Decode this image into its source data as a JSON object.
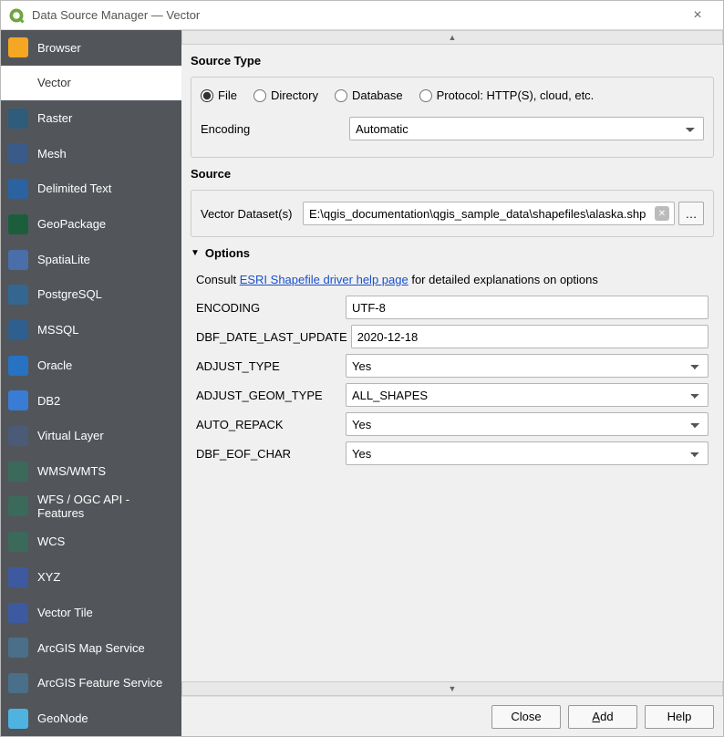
{
  "window": {
    "title": "Data Source Manager — Vector"
  },
  "sidebar": {
    "items": [
      {
        "label": "Browser",
        "icon": "folder-icon",
        "color": "#f5a623"
      },
      {
        "label": "Vector",
        "icon": "vector-icon",
        "color": "#ffffff",
        "active": true
      },
      {
        "label": "Raster",
        "icon": "raster-icon",
        "color": "#2e5c7a"
      },
      {
        "label": "Mesh",
        "icon": "mesh-icon",
        "color": "#3a5a8a"
      },
      {
        "label": "Delimited Text",
        "icon": "delimited-icon",
        "color": "#2b62a0"
      },
      {
        "label": "GeoPackage",
        "icon": "geopackage-icon",
        "color": "#1c5e3c"
      },
      {
        "label": "SpatiaLite",
        "icon": "spatialite-icon",
        "color": "#4a6ea9"
      },
      {
        "label": "PostgreSQL",
        "icon": "postgresql-icon",
        "color": "#336791"
      },
      {
        "label": "MSSQL",
        "icon": "mssql-icon",
        "color": "#2f5f8f"
      },
      {
        "label": "Oracle",
        "icon": "oracle-icon",
        "color": "#2772c3"
      },
      {
        "label": "DB2",
        "icon": "db2-icon",
        "color": "#3a7bd5"
      },
      {
        "label": "Virtual Layer",
        "icon": "virtual-icon",
        "color": "#4b5a77"
      },
      {
        "label": "WMS/WMTS",
        "icon": "wms-icon",
        "color": "#3b6a5a"
      },
      {
        "label": "WFS / OGC API - Features",
        "icon": "wfs-icon",
        "color": "#3b6a5a"
      },
      {
        "label": "WCS",
        "icon": "wcs-icon",
        "color": "#3b6a5a"
      },
      {
        "label": "XYZ",
        "icon": "xyz-icon",
        "color": "#3d5aa0"
      },
      {
        "label": "Vector Tile",
        "icon": "vectortile-icon",
        "color": "#3d5aa0"
      },
      {
        "label": "ArcGIS Map Service",
        "icon": "arcgis-map-icon",
        "color": "#4a6f88"
      },
      {
        "label": "ArcGIS Feature Service",
        "icon": "arcgis-feature-icon",
        "color": "#4a6f88"
      },
      {
        "label": "GeoNode",
        "icon": "geonode-icon",
        "color": "#4fb3e0"
      }
    ]
  },
  "sourceType": {
    "title": "Source Type",
    "options": {
      "file": "File",
      "directory": "Directory",
      "database": "Database",
      "protocol": "Protocol: HTTP(S), cloud, etc."
    },
    "selected": "file",
    "encodingLabel": "Encoding",
    "encodingValue": "Automatic"
  },
  "source": {
    "title": "Source",
    "datasetLabel": "Vector Dataset(s)",
    "path": "E:\\qgis_documentation\\qgis_sample_data\\shapefiles\\alaska.shp",
    "browseLabel": "…"
  },
  "options": {
    "title": "Options",
    "helpPrefix": "Consult ",
    "helpLink": "ESRI Shapefile driver help page",
    "helpSuffix": " for detailed explanations on options",
    "rows": [
      {
        "key": "ENCODING",
        "type": "text",
        "value": "UTF-8"
      },
      {
        "key": "DBF_DATE_LAST_UPDATE",
        "type": "text",
        "value": "2020-12-18"
      },
      {
        "key": "ADJUST_TYPE",
        "type": "select",
        "value": "Yes"
      },
      {
        "key": "ADJUST_GEOM_TYPE",
        "type": "select",
        "value": "ALL_SHAPES"
      },
      {
        "key": "AUTO_REPACK",
        "type": "select",
        "value": "Yes"
      },
      {
        "key": "DBF_EOF_CHAR",
        "type": "select",
        "value": "Yes"
      }
    ]
  },
  "buttons": {
    "close": "Close",
    "add": "Add",
    "help": "Help"
  }
}
